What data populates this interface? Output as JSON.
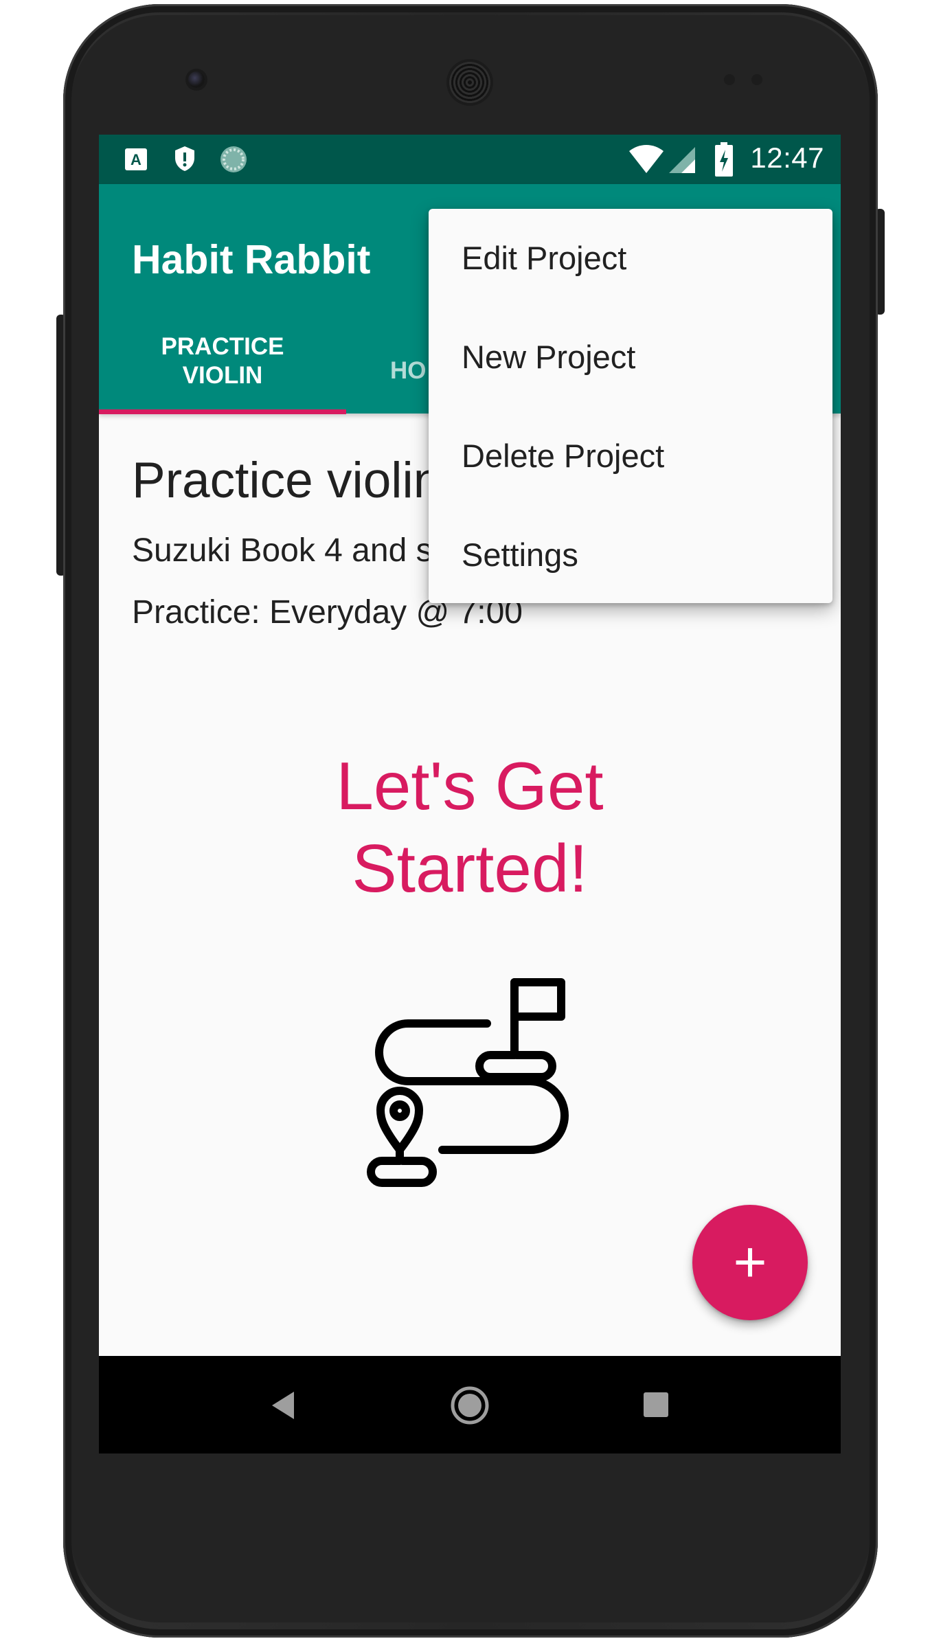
{
  "status_bar": {
    "time": "12:47",
    "left_icons": [
      "app-a-notification-icon",
      "shield-notification-icon",
      "sync-notification-icon"
    ],
    "right_icons": [
      "wifi-icon",
      "cell-signal-icon",
      "battery-charging-icon"
    ]
  },
  "app_bar": {
    "title": "Habit Rabbit",
    "tabs": [
      {
        "label_line1": "PRACTICE",
        "label_line2": "VIOLIN",
        "selected": true
      },
      {
        "label_line1": "HO",
        "label_line2": "",
        "selected": false
      }
    ]
  },
  "menu": {
    "items": [
      {
        "label": "Edit Project"
      },
      {
        "label": "New Project"
      },
      {
        "label": "Delete Project"
      },
      {
        "label": "Settings"
      }
    ]
  },
  "content": {
    "title": "Practice violin",
    "description": "Suzuki Book 4 and scales",
    "schedule": "Practice: Everyday @ 7:00",
    "cta_line1": "Let's Get",
    "cta_line2": "Started!",
    "illustration_icon": "route-map-icon"
  },
  "fab": {
    "icon": "plus-icon",
    "symbol": "+"
  },
  "nav_bar": {
    "icons": [
      "back-icon",
      "home-icon",
      "recents-icon"
    ]
  },
  "colors": {
    "primary": "#00897b",
    "primary_dark": "#00574b",
    "accent": "#d81b60",
    "background": "#fafafa",
    "text": "#212121"
  }
}
